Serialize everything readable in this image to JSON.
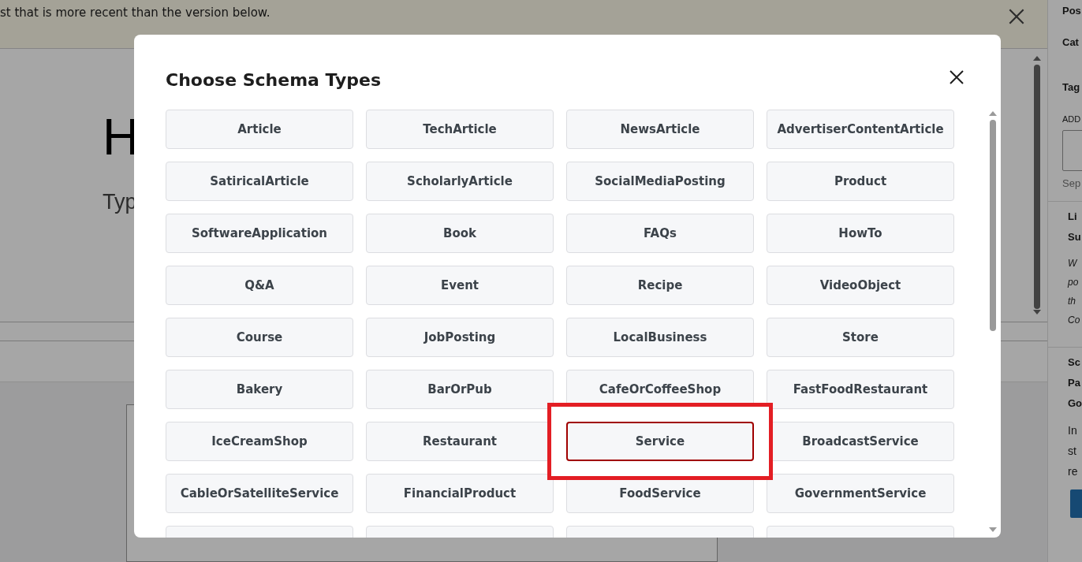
{
  "notice": {
    "text": "st that is more recent than the version below."
  },
  "editor": {
    "title": "H",
    "placeholder": "Typ"
  },
  "sidebar": {
    "tab": "Pos",
    "section": "Cat",
    "tags_heading": "Tag",
    "add_label": "ADD",
    "hint": "Sep",
    "panels": [
      {
        "heading": [
          "Li",
          "Su"
        ],
        "lines": [
          "W",
          "po",
          "th",
          "Co"
        ],
        "italic": true
      },
      {
        "heading": [
          "Sc",
          "Pa",
          "Go"
        ],
        "lines": [
          "In",
          "st",
          "re"
        ],
        "italic": false
      }
    ]
  },
  "modal": {
    "title": "Choose Schema Types",
    "types": [
      {
        "label": "Article",
        "selected": false
      },
      {
        "label": "TechArticle",
        "selected": false
      },
      {
        "label": "NewsArticle",
        "selected": false
      },
      {
        "label": "AdvertiserContentArticle",
        "selected": false
      },
      {
        "label": "SatiricalArticle",
        "selected": false
      },
      {
        "label": "ScholarlyArticle",
        "selected": false
      },
      {
        "label": "SocialMediaPosting",
        "selected": false
      },
      {
        "label": "Product",
        "selected": false
      },
      {
        "label": "SoftwareApplication",
        "selected": false
      },
      {
        "label": "Book",
        "selected": false
      },
      {
        "label": "FAQs",
        "selected": false
      },
      {
        "label": "HowTo",
        "selected": false
      },
      {
        "label": "Q&A",
        "selected": false
      },
      {
        "label": "Event",
        "selected": false
      },
      {
        "label": "Recipe",
        "selected": false
      },
      {
        "label": "VideoObject",
        "selected": false
      },
      {
        "label": "Course",
        "selected": false
      },
      {
        "label": "JobPosting",
        "selected": false
      },
      {
        "label": "LocalBusiness",
        "selected": false
      },
      {
        "label": "Store",
        "selected": false
      },
      {
        "label": "Bakery",
        "selected": false
      },
      {
        "label": "BarOrPub",
        "selected": false
      },
      {
        "label": "CafeOrCoffeeShop",
        "selected": false
      },
      {
        "label": "FastFoodRestaurant",
        "selected": false
      },
      {
        "label": "IceCreamShop",
        "selected": false
      },
      {
        "label": "Restaurant",
        "selected": false
      },
      {
        "label": "Service",
        "selected": true
      },
      {
        "label": "BroadcastService",
        "selected": false
      },
      {
        "label": "CableOrSatelliteService",
        "selected": false
      },
      {
        "label": "FinancialProduct",
        "selected": false
      },
      {
        "label": "FoodService",
        "selected": false
      },
      {
        "label": "GovernmentService",
        "selected": false
      },
      {
        "selected": false
      },
      {
        "selected": false
      },
      {
        "selected": false
      },
      {
        "selected": false
      }
    ]
  }
}
